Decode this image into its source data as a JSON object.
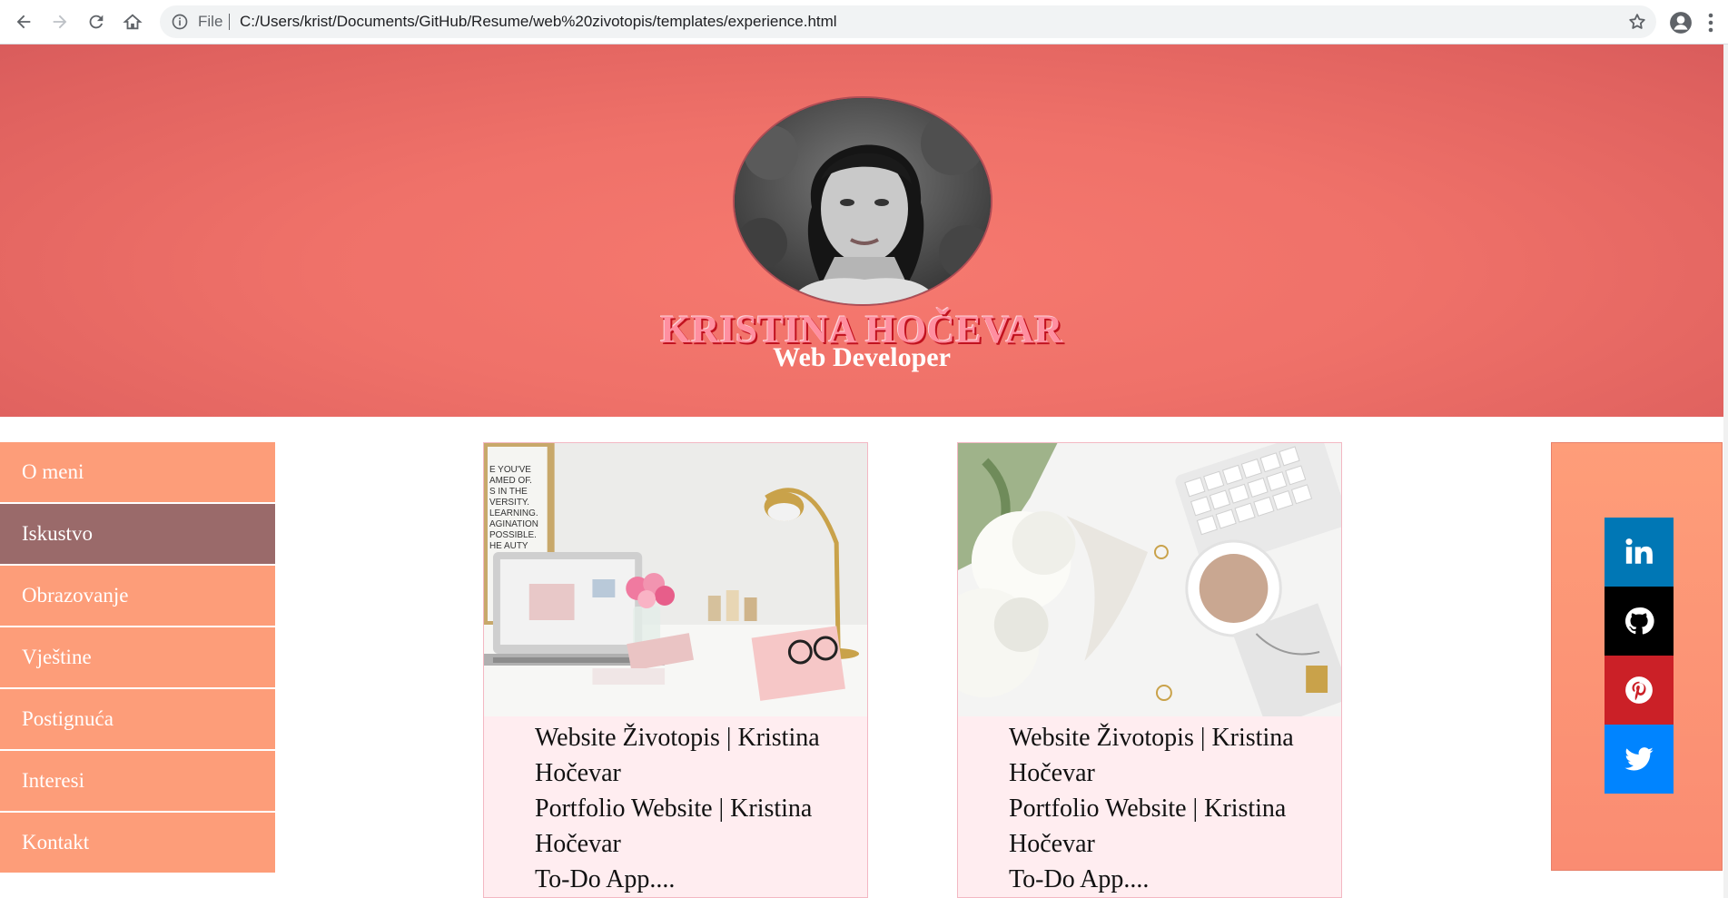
{
  "browser": {
    "file_label": "File",
    "url": "C:/Users/krist/Documents/GitHub/Resume/web%20zivotopis/templates/experience.html"
  },
  "hero": {
    "name": "KRISTINA HOČEVAR",
    "role": "Web Developer"
  },
  "nav": {
    "items": [
      {
        "label": "O meni"
      },
      {
        "label": "Iskustvo",
        "active": true
      },
      {
        "label": "Obrazovanje"
      },
      {
        "label": "Vještine"
      },
      {
        "label": "Postignuća"
      },
      {
        "label": "Interesi"
      },
      {
        "label": "Kontakt"
      }
    ]
  },
  "cards": [
    {
      "lines": [
        "Website Životopis | Kristina",
        "Hočevar",
        "Portfolio Website | Kristina",
        "Hočevar",
        "To-Do App...."
      ]
    },
    {
      "lines": [
        "Website Životopis | Kristina",
        "Hočevar",
        "Portfolio Website | Kristina",
        "Hočevar",
        "To-Do App...."
      ]
    }
  ],
  "social": [
    {
      "icon": "linkedin-icon",
      "color": "#0077b5"
    },
    {
      "icon": "github-icon",
      "color": "#000000"
    },
    {
      "icon": "pinterest-icon",
      "color": "#cb2027"
    },
    {
      "icon": "twitter-icon",
      "color": "#0084ff"
    }
  ],
  "colors": {
    "nav_bg": "#fd9d79",
    "nav_active": "#9a6a6a",
    "card_bg": "#ffedf0",
    "hero": "#ef7169"
  }
}
